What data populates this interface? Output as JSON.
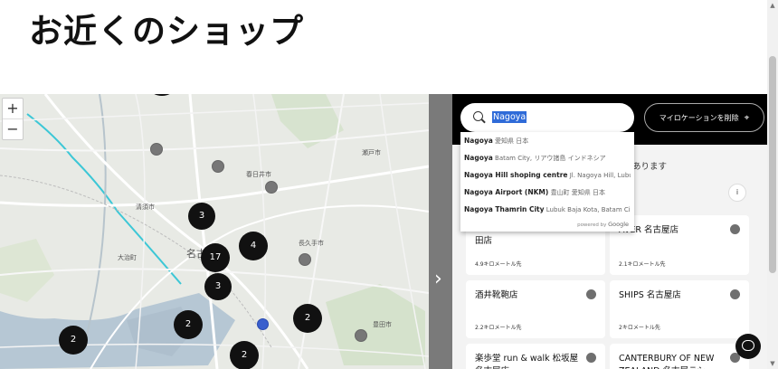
{
  "page": {
    "title": "お近くのショップ"
  },
  "map": {
    "zoom_in": "+",
    "zoom_out": "−",
    "clusters": [
      "3",
      "17",
      "4",
      "3",
      "2",
      "2",
      "2",
      "2"
    ],
    "town_labels": [
      "名古屋市",
      "豊田市",
      "春日井市",
      "長久手市",
      "大治町",
      "清須市",
      "瀬戸市"
    ]
  },
  "collapse": {
    "icon": "chevron-right-icon"
  },
  "search": {
    "value": "Nagoya",
    "icon": "search-icon",
    "remove_location_label": "マイロケーションを削除",
    "remove_location_icon": "crosshair-icon"
  },
  "autocomplete": {
    "items": [
      {
        "main": "Nagoya",
        "sub": "愛知県 日本"
      },
      {
        "main": "Nagoya",
        "sub": "Batam City, リアウ諸島 インドネシア"
      },
      {
        "main": "Nagoya Hill shoping centre",
        "sub": "Jl. Nagoya Hill, Lubuk B..."
      },
      {
        "main": "Nagoya Airport (NKM)",
        "sub": "豊山町 愛知県 日本"
      },
      {
        "main": "Nagoya Thamrin City",
        "sub": "Lubuk Baja Kota, Batam City, ..."
      }
    ],
    "powered_by": "powered by",
    "powered_brand": "Google"
  },
  "results": {
    "info_text": "あります",
    "info_icon": "i",
    "cards": [
      {
        "name": "田店",
        "distance": "4.9キロメートル先"
      },
      {
        "name": "AVER 名古屋店",
        "distance": "2.1キロメートル先"
      },
      {
        "name": "酒井靴鞄店",
        "distance": "2.2キロメートル先"
      },
      {
        "name": "SHIPS 名古屋店",
        "distance": "2キロメートル先"
      },
      {
        "name": "楽歩堂 run & walk 松坂屋名古屋店",
        "distance": ""
      },
      {
        "name": "CANTERBURY OF NEW ZEALAND 名古屋ラシ",
        "distance": ""
      }
    ]
  },
  "chat": {
    "icon": "chat-icon"
  }
}
